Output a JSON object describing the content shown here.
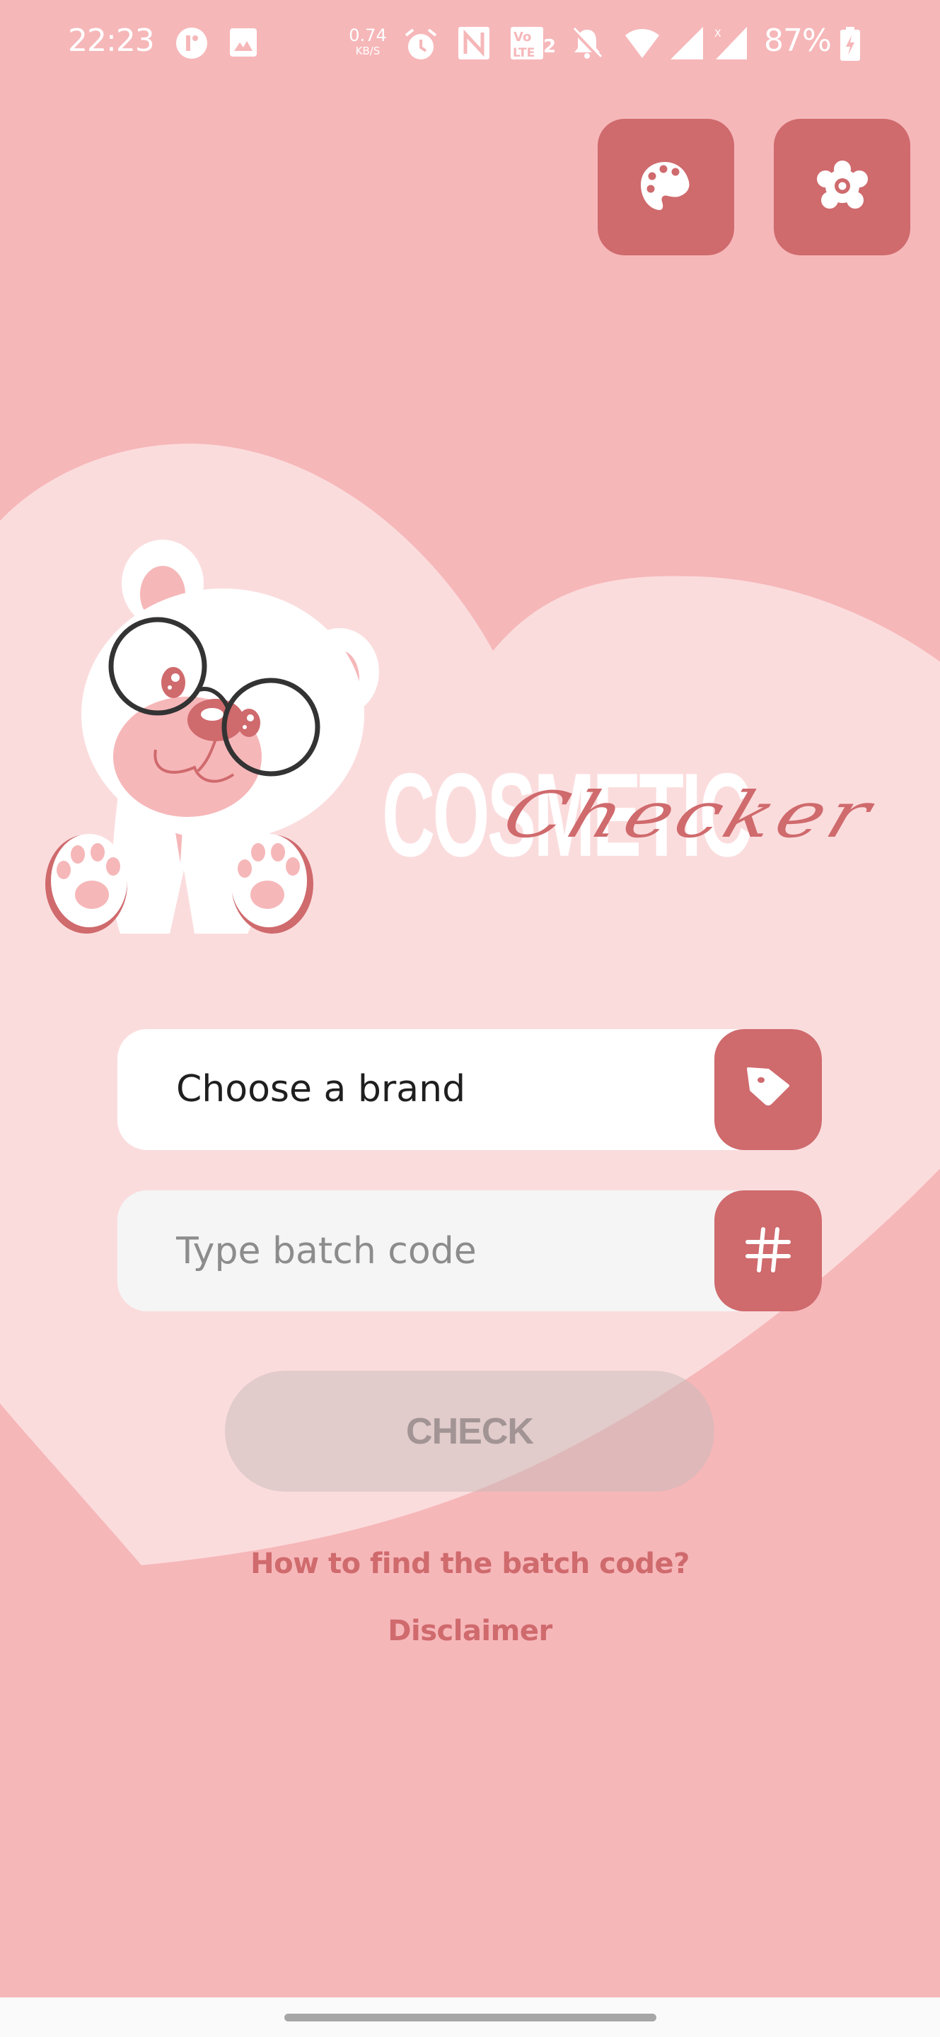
{
  "status_bar": {
    "time": "22:23",
    "network_speed_value": "0.74",
    "network_speed_unit": "KB/S",
    "battery_percent": "87%",
    "icons": [
      "app-notification-icon",
      "gallery-icon",
      "alarm-icon",
      "nfc-icon",
      "volte-2-icon",
      "mute-icon",
      "wifi-icon",
      "signal-icon",
      "signal-no-data-icon",
      "battery-charging-icon"
    ]
  },
  "toolbar": {
    "theme_button_icon": "palette-icon",
    "settings_button_icon": "gear-icon"
  },
  "logo": {
    "word1": "COSMETIC",
    "word2": "Checker"
  },
  "form": {
    "brand_field_text": "Choose a brand",
    "brand_button_icon": "tag-icon",
    "batch_field_placeholder": "Type batch code",
    "batch_field_value": "",
    "batch_button_icon": "hash-icon",
    "hash_glyph": "#",
    "check_button_label": "CHECK"
  },
  "links": {
    "how_to_find": "How to find the batch code?",
    "disclaimer": "Disclaimer"
  },
  "colors": {
    "background": "#f6b7b9",
    "heart": "#fbdcdd",
    "accent": "#cf6a6d",
    "field_bg": "#ffffff",
    "check_disabled": "#ddc4c5"
  }
}
